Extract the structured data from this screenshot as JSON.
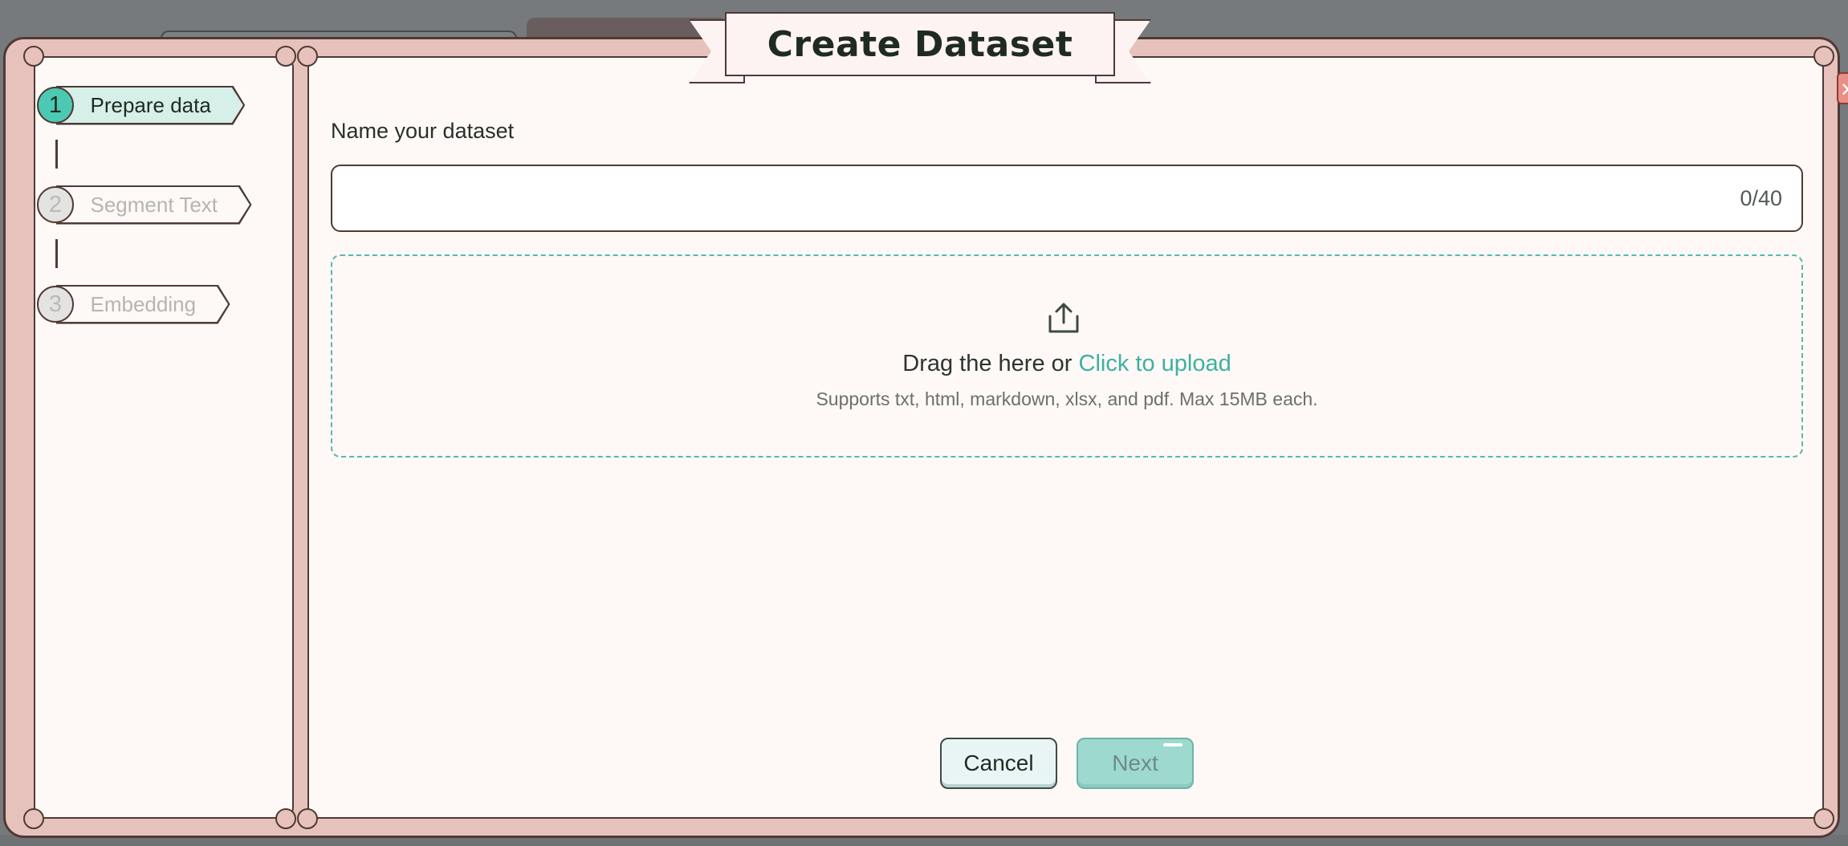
{
  "dialog": {
    "title": "Create Dataset",
    "close_label": "✕"
  },
  "steps": [
    {
      "number": "1",
      "label": "Prepare data",
      "state": "active"
    },
    {
      "number": "2",
      "label": "Segment Text",
      "state": "inactive"
    },
    {
      "number": "3",
      "label": "Embedding",
      "state": "inactive"
    }
  ],
  "form": {
    "name_label": "Name your dataset",
    "name_value": "",
    "name_placeholder": "",
    "char_count": "0/40"
  },
  "upload": {
    "icon": "upload-icon",
    "prompt": "Drag the here or ",
    "link_text": "Click to upload",
    "hint": "Supports txt, html, markdown, xlsx, and pdf. Max 15MB each."
  },
  "footer": {
    "cancel_label": "Cancel",
    "next_label": "Next"
  },
  "colors": {
    "frame": "#e7c2bc",
    "border": "#4f3a34",
    "panel": "#fef9f6",
    "accent": "#4cc9b2",
    "link": "#3db1a2",
    "dropzone_border": "#55b8ad"
  }
}
